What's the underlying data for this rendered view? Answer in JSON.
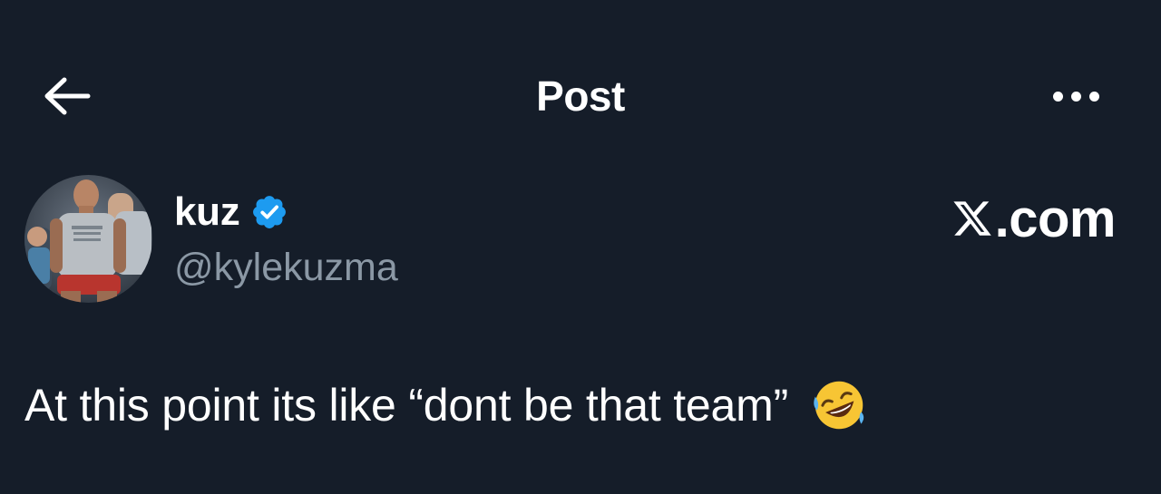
{
  "header": {
    "title": "Post",
    "back_icon": "arrow-left-icon",
    "more_icon": "more-horizontal-icon"
  },
  "author": {
    "name": "kuz",
    "handle": "@kylekuzma",
    "verified": true,
    "verified_color": "#1d9bf0"
  },
  "watermark": {
    "logo_icon": "x-logo-icon",
    "text": ".com"
  },
  "post": {
    "text": "At this point its like “dont be that team”",
    "emoji": "rolling-on-the-floor-laughing"
  },
  "colors": {
    "background": "#151d29",
    "text_primary": "#ffffff",
    "text_secondary": "#8b98a5",
    "accent": "#1d9bf0"
  }
}
